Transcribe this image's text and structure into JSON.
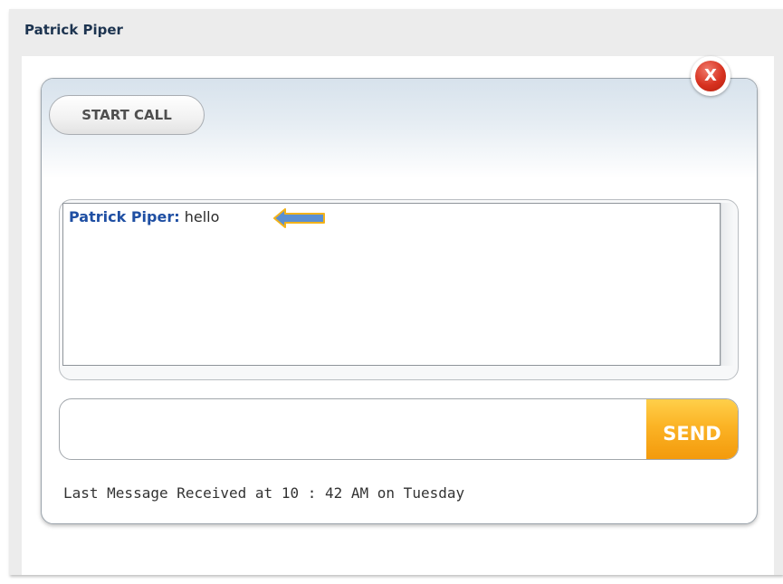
{
  "window": {
    "title": "Patrick Piper"
  },
  "toolbar": {
    "start_call_label": "START CALL",
    "close_label": "X"
  },
  "conversation": {
    "messages": [
      {
        "sender": "Patrick Piper:",
        "text": "hello"
      }
    ]
  },
  "composer": {
    "input_value": "",
    "send_label": "SEND"
  },
  "status": {
    "text": "Last Message Received at 10 : 42 AM on Tuesday"
  },
  "colors": {
    "sender": "#1f4fa3",
    "send_button": "#f8a818",
    "close_button": "#d7311f",
    "arrow_fill": "#5b8fd1",
    "arrow_outline": "#f2b21a"
  },
  "icons": {
    "close": "close-icon",
    "pointer": "left-arrow-icon"
  }
}
